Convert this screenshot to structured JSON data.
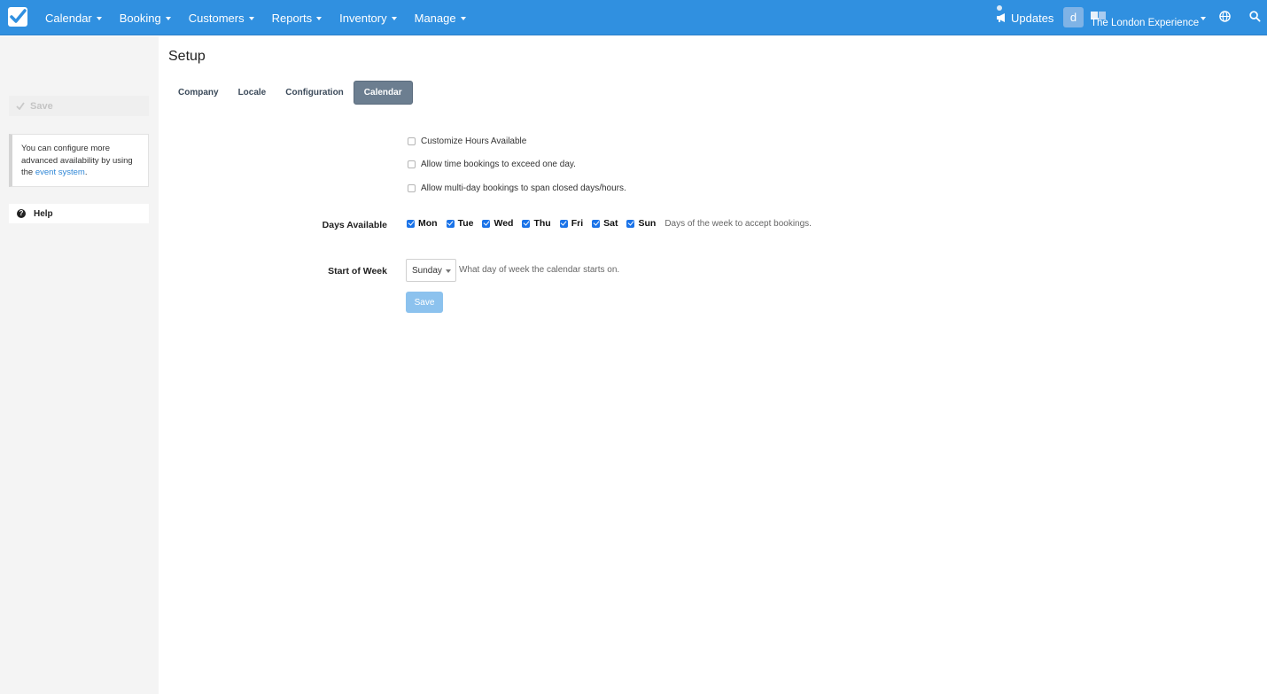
{
  "nav": {
    "items": [
      {
        "label": "Calendar"
      },
      {
        "label": "Booking"
      },
      {
        "label": "Customers"
      },
      {
        "label": "Reports"
      },
      {
        "label": "Inventory"
      },
      {
        "label": "Manage"
      }
    ],
    "updates_label": "Updates",
    "avatar_initial": "d",
    "company_name": "The London Experience"
  },
  "sidebar": {
    "save_label": "Save",
    "note_text": "You can configure more advanced availability by using the",
    "note_link": "event system",
    "note_tail": ".",
    "help_label": "Help"
  },
  "page": {
    "title": "Setup",
    "tabs": [
      {
        "label": "Company",
        "active": false
      },
      {
        "label": "Locale",
        "active": false
      },
      {
        "label": "Configuration",
        "active": false
      },
      {
        "label": "Calendar",
        "active": true
      }
    ]
  },
  "form": {
    "options": [
      {
        "label": "Customize Hours Available",
        "checked": false
      },
      {
        "label": "Allow time bookings to exceed one day.",
        "checked": false
      },
      {
        "label": "Allow multi-day bookings to span closed days/hours.",
        "checked": false
      }
    ],
    "days_label": "Days Available",
    "days": [
      {
        "label": "Mon",
        "checked": true
      },
      {
        "label": "Tue",
        "checked": true
      },
      {
        "label": "Wed",
        "checked": true
      },
      {
        "label": "Thu",
        "checked": true
      },
      {
        "label": "Fri",
        "checked": true
      },
      {
        "label": "Sat",
        "checked": true
      },
      {
        "label": "Sun",
        "checked": true
      }
    ],
    "days_help": "Days of the week to accept bookings.",
    "week_label": "Start of Week",
    "week_value": "Sunday",
    "week_help": "What day of week the calendar starts on.",
    "save_label": "Save"
  },
  "colors": {
    "nav_bg": "#3090e0",
    "active_tab": "#6c7e90",
    "link": "#2e86d6",
    "save_button": "#8cc2ee"
  }
}
